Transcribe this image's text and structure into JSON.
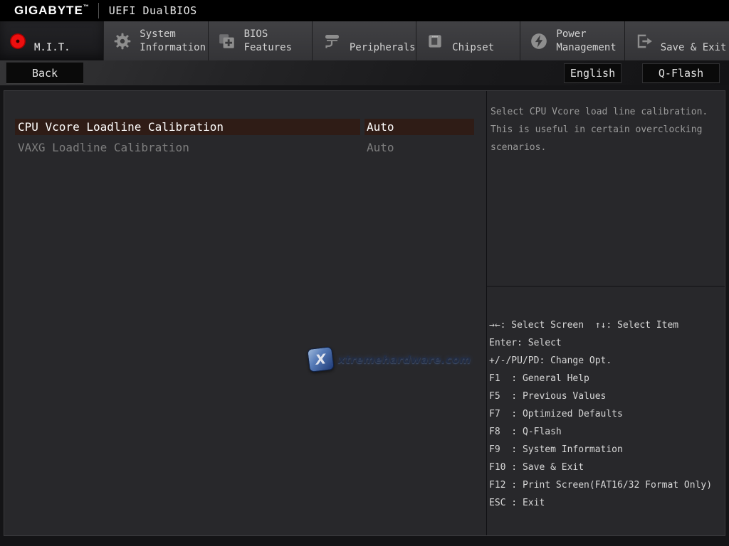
{
  "topbar": {
    "brand": "GIGABYTE",
    "trademark": "™",
    "title": "UEFI DualBIOS"
  },
  "tabs": [
    {
      "l1": "",
      "l2": "M.I.T."
    },
    {
      "l1": "System",
      "l2": "Information"
    },
    {
      "l1": "BIOS",
      "l2": "Features"
    },
    {
      "l1": "",
      "l2": "Peripherals"
    },
    {
      "l1": "",
      "l2": "Chipset"
    },
    {
      "l1": "Power",
      "l2": "Management"
    },
    {
      "l1": "",
      "l2": "Save & Exit"
    }
  ],
  "toolbar": {
    "back_label": "Back",
    "language_label": "English",
    "qflash_label": "Q-Flash"
  },
  "settings": {
    "rows": [
      {
        "label": "CPU Vcore Loadline Calibration",
        "value": "Auto"
      },
      {
        "label": "VAXG Loadline Calibration",
        "value": "Auto"
      }
    ]
  },
  "help_panel": {
    "text": "Select CPU Vcore load line calibration.\nThis is useful in certain overclocking\nscenarios."
  },
  "legend": {
    "lines": [
      "→←: Select Screen  ↑↓: Select Item",
      "Enter: Select",
      "+/-/PU/PD: Change Opt.",
      "F1  : General Help",
      "F5  : Previous Values",
      "F7  : Optimized Defaults",
      "F8  : Q-Flash",
      "F9  : System Information",
      "F10 : Save & Exit",
      "F12 : Print Screen(FAT16/32 Format Only)",
      "ESC : Exit"
    ]
  },
  "watermark": {
    "logo_letter": "X",
    "text": "xtremehardware.com"
  },
  "colors": {
    "accent_red": "#ed0f0f",
    "highlight_bg": "#2f1c16",
    "panel_bg": "#28282b",
    "tab_inactive_bg": "#3b3b3d",
    "tab_active_bg": "#1c1c1e"
  }
}
